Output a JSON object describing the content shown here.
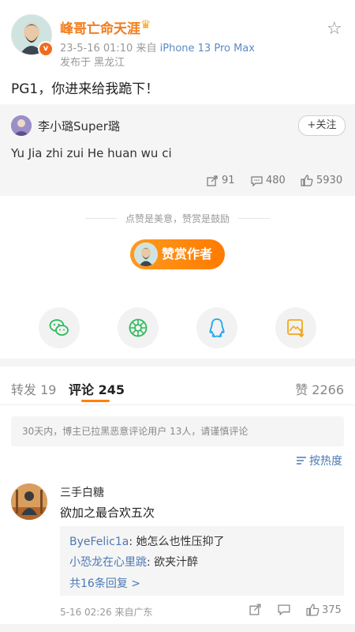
{
  "post": {
    "author": "峰哥亡命天涯",
    "time": "23-5-16 01:10",
    "source_prefix": "来自",
    "device": "iPhone 13 Pro Max",
    "location": "发布于 黑龙江",
    "text": "PG1，你进来给我跪下！"
  },
  "repost": {
    "user": "李小璐Super璐",
    "follow_label": "+关注",
    "text": "Yu Jia zhi zui He huan wu ci",
    "reposts": "91",
    "comments": "480",
    "likes": "5930"
  },
  "reward": {
    "caption": "点赞是美意，赞赏是鼓励",
    "button_label": "赞赏作者"
  },
  "share_icons": [
    "wechat-icon",
    "moments-icon",
    "qq-icon",
    "save-image-icon"
  ],
  "tabs": {
    "repost": "转发 19",
    "comment": "评论 245",
    "like": "赞 2266"
  },
  "notice": "30天内，博主已拉黑恶意评论用户 13人，请谨慎评论",
  "sort_label": "按热度",
  "comment": {
    "user": "三手白糖",
    "text": "欲加之最合欢五次",
    "replies": [
      {
        "user": "ByeFelic1a",
        "text": ": 她怎么也性压抑了"
      },
      {
        "user": "小恐龙在心里跳",
        "text": ": 欲夹汁醉"
      }
    ],
    "more_replies": "共16条回复 >",
    "time": "5-16 02:26 来自广东",
    "likes": "375"
  },
  "colors": {
    "accent": "#ff8200",
    "link": "#4b79b5",
    "author": "#f27d1a"
  }
}
